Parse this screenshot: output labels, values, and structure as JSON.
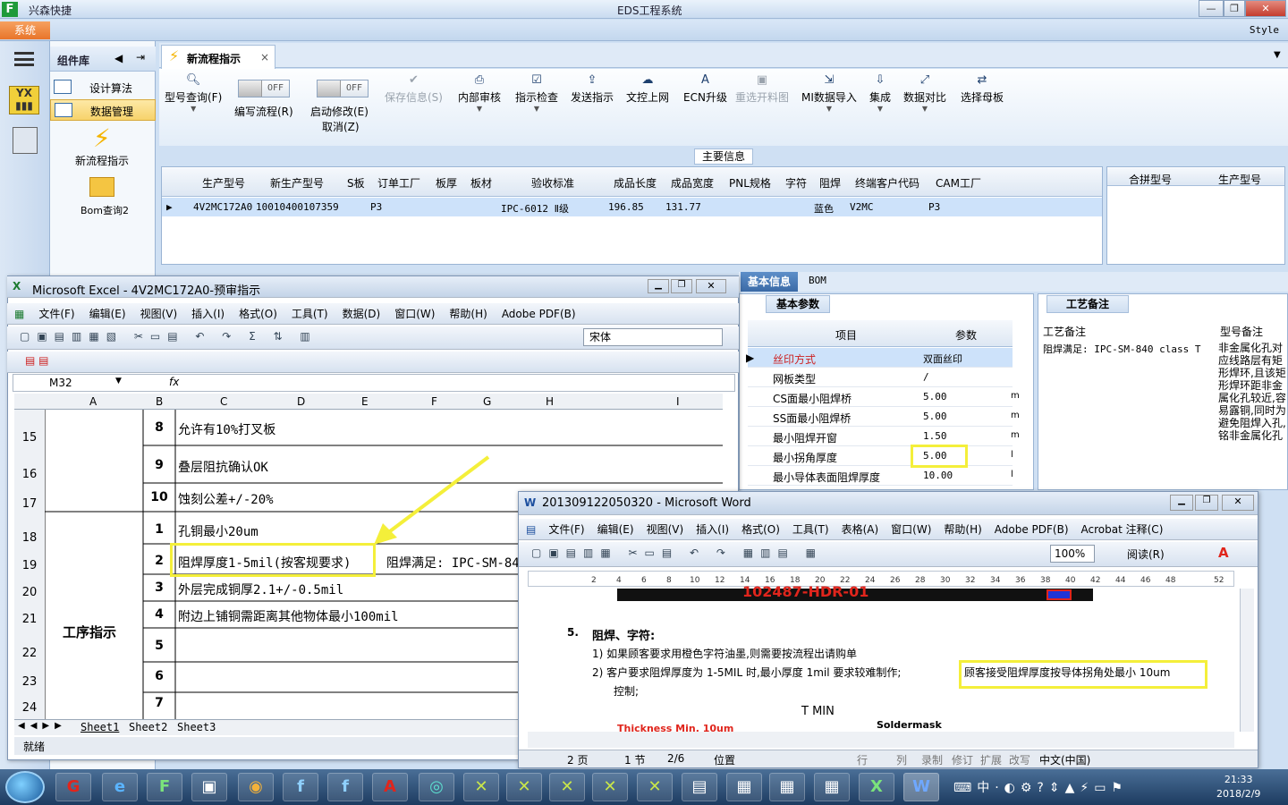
{
  "app": {
    "name": "兴森快捷",
    "title": "EDS工程系统",
    "system_menu": "系统",
    "style_label": "Style"
  },
  "components": {
    "title": "组件库",
    "items": [
      "设计算法",
      "数据管理"
    ],
    "tiles": [
      "新流程指示",
      "Bom查询2"
    ]
  },
  "tab": {
    "label": "新流程指示"
  },
  "toolbar": {
    "model_query": "型号查询(F)",
    "write_flow": "编写流程(R)",
    "start_edit": "启动修改(E)",
    "cancel": "取消(Z)",
    "off": "OFF",
    "save_info": "保存信息(S)",
    "internal_review": "内部审核",
    "instruction_check": "指示检查",
    "send_instruction": "发送指示",
    "upload_network": "文控上网",
    "ecn_upgrade": "ECN升级",
    "reselect_cut": "重选开料图",
    "mi_import": "MI数据导入",
    "integrate": "集成",
    "data_compare": "数据对比",
    "select_master": "选择母板"
  },
  "main_info": {
    "label": "主要信息",
    "headers": [
      "生产型号",
      "新生产型号",
      "S板",
      "订单工厂",
      "板厚",
      "板材",
      "验收标准",
      "成品长度",
      "成品宽度",
      "PNL规格",
      "字符",
      "阻焊",
      "终端客户代码",
      "CAM工厂"
    ],
    "row": [
      "4V2MC172A0",
      "10010400107359",
      "P3",
      "",
      "",
      "",
      "IPC-6012 Ⅱ级",
      "196.85",
      "131.77",
      "",
      "",
      "蓝色",
      "V2MC",
      "P3"
    ]
  },
  "right_grid": {
    "headers": [
      "合拼型号",
      "生产型号"
    ]
  },
  "basic": {
    "tab_basic": "基本信息",
    "tab_bom": "BOM",
    "title": "基本参数",
    "col_item": "项目",
    "col_param": "参数",
    "rows": [
      {
        "name": "丝印方式",
        "value": "双面丝印",
        "unit": ""
      },
      {
        "name": "网板类型",
        "value": "/",
        "unit": ""
      },
      {
        "name": "CS面最小阻焊桥",
        "value": "5.00",
        "unit": "m"
      },
      {
        "name": "SS面最小阻焊桥",
        "value": "5.00",
        "unit": "m"
      },
      {
        "name": "最小阻焊开窗",
        "value": "1.50",
        "unit": "m"
      },
      {
        "name": "最小拐角厚度",
        "value": "5.00",
        "unit": "l"
      },
      {
        "name": "最小导体表面阻焊厚度",
        "value": "10.00",
        "unit": "l"
      }
    ]
  },
  "craft": {
    "title": "工艺备注",
    "col1": "工艺备注",
    "col2": "型号备注",
    "note1": "阻焊满足: IPC-SM-840 class T",
    "note2": "非金属化孔对应线路层有矩形焊环,且该矩形焊环距非金属化孔较近,容易露铜,同时为避免阻焊入孔,铭非金属化孔"
  },
  "excel": {
    "title": "Microsoft Excel - 4V2MC172A0-预审指示",
    "menu": [
      "文件(F)",
      "编辑(E)",
      "视图(V)",
      "插入(I)",
      "格式(O)",
      "工具(T)",
      "数据(D)",
      "窗口(W)",
      "帮助(H)",
      "Adobe PDF(B)"
    ],
    "font": "宋体",
    "cell_ref": "M32",
    "fx": "fx",
    "cols": [
      "A",
      "B",
      "C",
      "D",
      "E",
      "F",
      "G",
      "H",
      "I"
    ],
    "rows": [
      {
        "r": "15",
        "n": "8",
        "text": "允许有10%打叉板"
      },
      {
        "r": "16",
        "n": "9",
        "text": "叠层阻抗确认OK"
      },
      {
        "r": "17",
        "n": "10",
        "text": "蚀刻公差+/-20%"
      },
      {
        "r": "18",
        "n": "1",
        "text": "孔铜最小20um"
      },
      {
        "r": "19",
        "n": "2",
        "text": "阻焊厚度1-5mil(按客规要求)",
        "extra": "阻焊满足: IPC-SM-84"
      },
      {
        "r": "20",
        "n": "3",
        "text": "外层完成铜厚2.1+/-0.5mil"
      },
      {
        "r": "21",
        "n": "4",
        "text": "附边上铺铜需距离其他物体最小100mil"
      },
      {
        "r": "22",
        "n": "5",
        "text": ""
      },
      {
        "r": "23",
        "n": "6",
        "text": ""
      },
      {
        "r": "24",
        "n": "7",
        "text": ""
      }
    ],
    "merged_label": "工序指示",
    "sheets": [
      "Sheet1",
      "Sheet2",
      "Sheet3"
    ],
    "status": "就绪"
  },
  "word": {
    "title": "201309122050320 - Microsoft Word",
    "menu": [
      "文件(F)",
      "编辑(E)",
      "视图(V)",
      "插入(I)",
      "格式(O)",
      "工具(T)",
      "表格(A)",
      "窗口(W)",
      "帮助(H)",
      "Adobe PDF(B)",
      "Acrobat 注释(C)"
    ],
    "zoom": "100%",
    "read": "阅读(R)",
    "ruler": [
      "2",
      "4",
      "6",
      "8",
      "10",
      "12",
      "14",
      "16",
      "18",
      "20",
      "22",
      "24",
      "26",
      "28",
      "30",
      "32",
      "34",
      "36",
      "38",
      "40",
      "42",
      "44",
      "46",
      "48",
      "52"
    ],
    "banner": "102487-HDR-01",
    "heading_num": "5.",
    "heading": "阻焊、字符:",
    "item1": "1) 如果顾客要求用橙色字符油墨,则需要按流程出请购单",
    "item2": "2) 客户要求阻焊厚度为 1-5MIL 时,最小厚度 1mil 要求较难制作;",
    "item2_hl": "顾客接受阻焊厚度按导体拐角处最小 10um",
    "item2_tail": "控制;",
    "fig_tmin": "T MIN",
    "fig_thick": "Thickness Min. 10um",
    "fig_solder": "Soldermask",
    "status": [
      "2 页",
      "1 节",
      "2/6",
      "位置",
      "行",
      "列",
      "录制",
      "修订",
      "扩展",
      "改写",
      "中文(中国)"
    ]
  },
  "taskbar": {
    "time": "21:33",
    "date": "2018/2/9",
    "ime": "中"
  },
  "colors": {
    "accent": "#3b6aa6",
    "highlight": "#f4ef3a",
    "red": "#e0251c"
  }
}
